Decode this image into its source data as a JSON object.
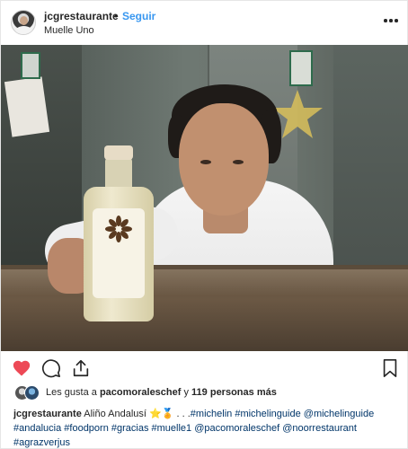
{
  "header": {
    "username": "jcgrestaurante",
    "separator": "•",
    "follow_label": "Seguir",
    "location": "Muelle Uno",
    "more_icon": "more-horizontal-icon"
  },
  "photo": {
    "subject": "chef-holding-bottle"
  },
  "actions": {
    "like_icon": "heart-filled-icon",
    "comment_icon": "comment-icon",
    "share_icon": "share-icon",
    "save_icon": "bookmark-icon",
    "like_color": "#ed4956"
  },
  "likes": {
    "prefix": "Les gusta a ",
    "user": "pacomoraleschef",
    "middle": " y ",
    "count": "119 personas más"
  },
  "caption": {
    "username": "jcgrestaurante",
    "text_start": "Aliño Andalusí",
    "emojis": "⭐🏅",
    "ellipsis": " . . .",
    "tags": [
      "#michelin",
      "#michelinguide",
      "@michelinguide",
      "#andalucia",
      "#foodporn",
      "#gracias",
      "#muelle1",
      "@pacomoraleschef",
      "@noorrestaurant",
      "#agrazverjus"
    ]
  }
}
